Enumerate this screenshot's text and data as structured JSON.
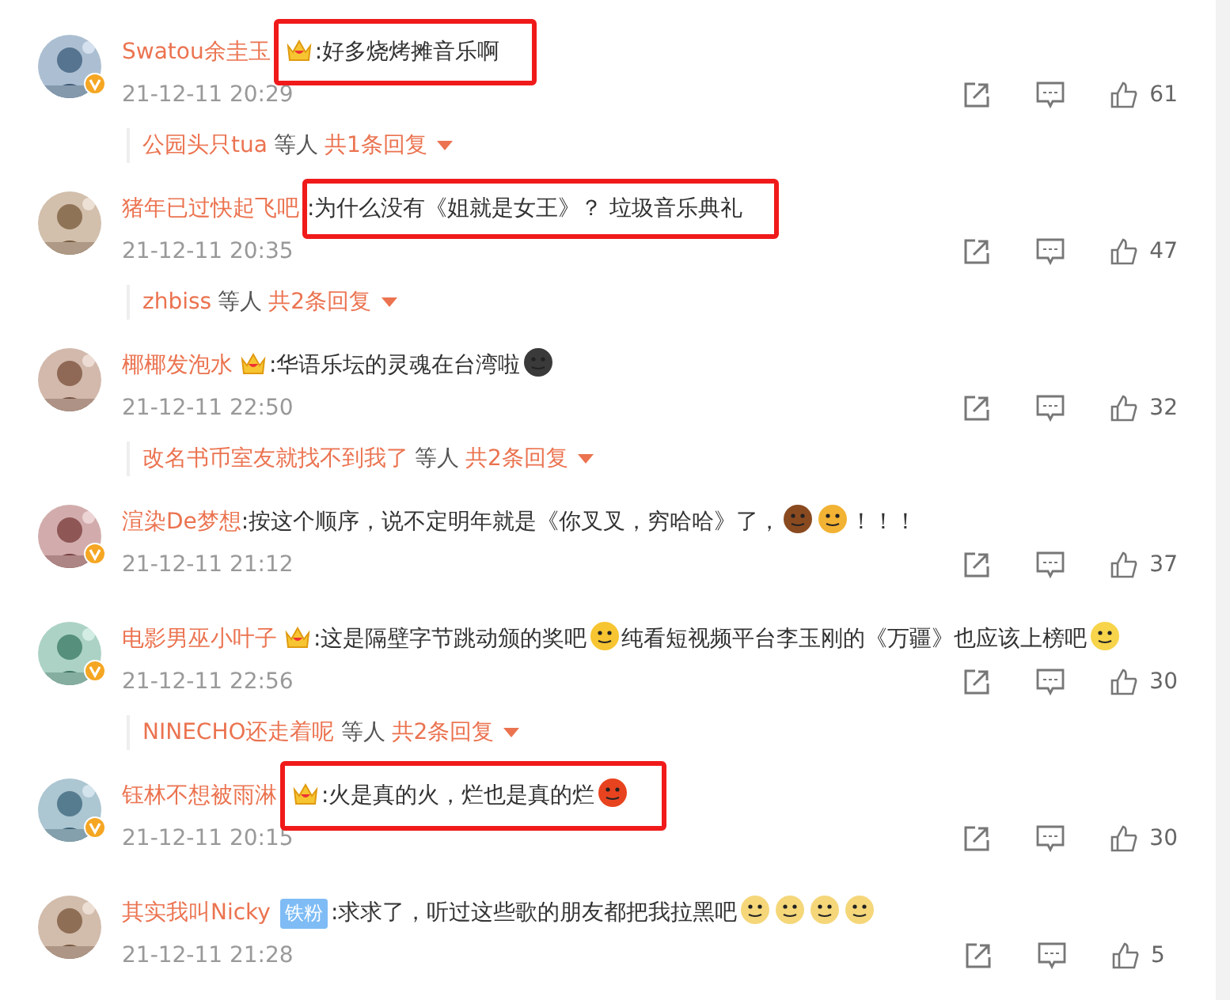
{
  "comments": [
    {
      "user": "Swatou余圭玉",
      "verified": true,
      "badge": {
        "kind": "crown"
      },
      "highlighted": true,
      "parts": [
        {
          "kind": "text",
          "text": ":好多烧烤摊音乐啊"
        }
      ],
      "time": "21-12-11 20:29",
      "likes": "61",
      "replies": {
        "names": "公园头只tua",
        "others": "等人",
        "count": "共1条回复"
      }
    },
    {
      "user": "猪年已过快起飞吧",
      "verified": false,
      "highlighted": true,
      "parts": [
        {
          "kind": "text",
          "text": ":为什么没有《姐就是女王》？ 垃圾音乐典礼"
        }
      ],
      "time": "21-12-11 20:35",
      "likes": "47",
      "replies": {
        "names": "zhbiss",
        "others": "等人",
        "count": "共2条回复"
      }
    },
    {
      "user": "椰椰发泡水",
      "verified": false,
      "badge": {
        "kind": "crown"
      },
      "highlighted": false,
      "parts": [
        {
          "kind": "text",
          "text": ":华语乐坛的灵魂在台湾啦"
        },
        {
          "kind": "emoji",
          "color": "#3a3a3a"
        }
      ],
      "time": "21-12-11 22:50",
      "likes": "32",
      "replies": {
        "names": "改名书币室友就找不到我了",
        "others": "等人",
        "count": "共2条回复"
      }
    },
    {
      "user": "渲染De梦想",
      "verified": true,
      "highlighted": false,
      "parts": [
        {
          "kind": "text",
          "text": ":按这个顺序，说不定明年就是《你叉叉，穷哈哈》了，"
        },
        {
          "kind": "emoji",
          "color": "#8a4a20"
        },
        {
          "kind": "emoji",
          "color": "#f2b233"
        },
        {
          "kind": "text",
          "text": "！！！"
        }
      ],
      "time": "21-12-11 21:12",
      "likes": "37"
    },
    {
      "user": "电影男巫小叶子",
      "verified": true,
      "badge": {
        "kind": "crown"
      },
      "highlighted": false,
      "parts": [
        {
          "kind": "text",
          "text": ":这是隔壁字节跳动颁的奖吧"
        },
        {
          "kind": "emoji",
          "color": "#f7c531"
        },
        {
          "kind": "text",
          "text": "纯看短视频平台李玉刚的《万疆》也应该上榜吧"
        },
        {
          "kind": "emoji",
          "color": "#f7d44a"
        }
      ],
      "time": "21-12-11 22:56",
      "likes": "30",
      "replies": {
        "names": "NINECHO还走着呢",
        "others": "等人",
        "count": "共2条回复"
      }
    },
    {
      "user": "钰林不想被雨淋",
      "verified": true,
      "badge": {
        "kind": "crown"
      },
      "highlighted": true,
      "parts": [
        {
          "kind": "text",
          "text": ":火是真的火，烂也是真的烂"
        },
        {
          "kind": "emoji",
          "color": "#e8431f"
        }
      ],
      "time": "21-12-11 20:15",
      "likes": "30"
    },
    {
      "user": "其实我叫Nicky",
      "verified": false,
      "badge": {
        "kind": "label",
        "text": "铁粉"
      },
      "highlighted": false,
      "parts": [
        {
          "kind": "text",
          "text": ":求求了，听过这些歌的朋友都把我拉黑吧"
        },
        {
          "kind": "emoji",
          "color": "#f5d77a"
        },
        {
          "kind": "emoji",
          "color": "#f5d77a"
        },
        {
          "kind": "emoji",
          "color": "#f5d77a"
        },
        {
          "kind": "emoji",
          "color": "#f5d77a"
        }
      ],
      "time": "21-12-11 21:28",
      "likes": "5"
    }
  ]
}
